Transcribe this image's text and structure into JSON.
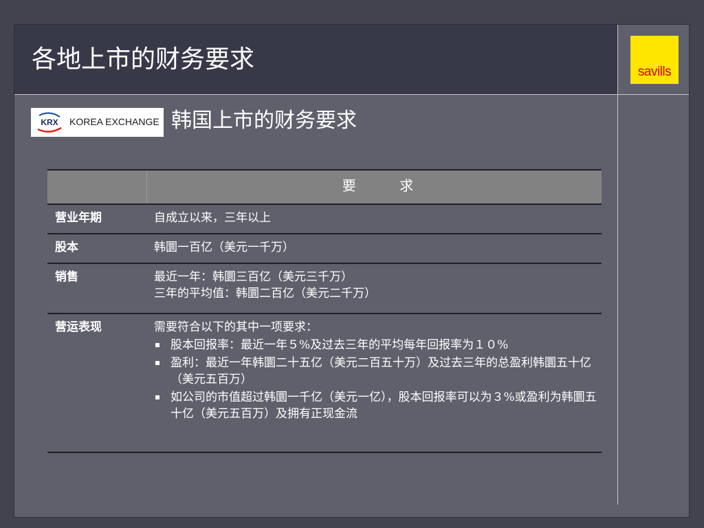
{
  "slide": {
    "title": "各地上市的财务要求",
    "subtitle": "韩国上市的财务要求"
  },
  "brand": {
    "savills_logo_text": "savills",
    "krx_logo": {
      "mark_text": "KRX",
      "name": "KOREA EXCHANGE"
    }
  },
  "table": {
    "header": {
      "col1": "",
      "col2": "要          求"
    },
    "rows": [
      {
        "label": "营业年期",
        "lines": [
          "自成立以来，三年以上"
        ]
      },
      {
        "label": "股本",
        "lines": [
          "韩圜一百亿（美元一千万）"
        ]
      },
      {
        "label": "销售",
        "lines": [
          "最近一年：韩圜三百亿（美元三千万）",
          "三年的平均值：韩圜二百亿（美元二千万）"
        ]
      },
      {
        "label": "营运表现",
        "intro": "需要符合以下的其中一项要求：",
        "bullets": [
          "股本回报率：最近一年５%及过去三年的平均每年回报率为１０%",
          "盈利：最近一年韩圜二十五亿（美元二百五十万）及过去三年的总盈利韩圜五十亿（美元五百万）",
          "如公司的市值超过韩圜一千亿（美元一亿），股本回报率可以为３%或盈利为韩圜五十亿（美元五百万）及拥有正现金流"
        ]
      }
    ]
  },
  "colors": {
    "background": "#42434f",
    "slide": "#5f606c",
    "title_bar": "#373848",
    "table_header": "#828282",
    "savills_yellow": "#ffe600",
    "savills_red": "#d6001c"
  }
}
